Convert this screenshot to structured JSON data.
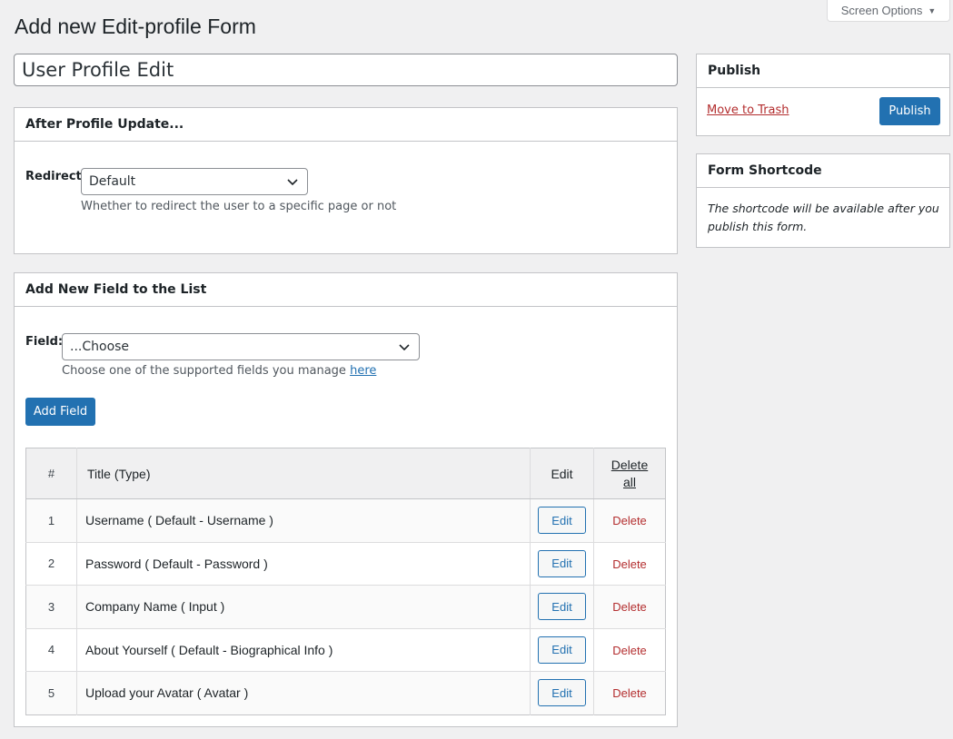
{
  "screen_options": {
    "label": "Screen Options"
  },
  "page_title": "Add new Edit-profile Form",
  "form_title": {
    "value": "User Profile Edit"
  },
  "after_update": {
    "header": "After Profile Update...",
    "redirect_label": "Redirect:",
    "redirect_value": "Default",
    "redirect_hint": "Whether to redirect the user to a specific page or not"
  },
  "add_field": {
    "header": "Add New Field to the List",
    "field_label": "Field:",
    "field_value": "...Choose",
    "hint_text": "Choose one of the supported fields you manage",
    "hint_link": "here",
    "button": "Add Field"
  },
  "table": {
    "headers": {
      "num": "#",
      "title": "Title (Type)",
      "edit": "Edit",
      "delete_all": "Delete all"
    },
    "edit_label": "Edit",
    "delete_label": "Delete",
    "rows": [
      {
        "num": "1",
        "title": "Username ( Default - Username )"
      },
      {
        "num": "2",
        "title": "Password ( Default - Password )"
      },
      {
        "num": "3",
        "title": "Company Name ( Input )"
      },
      {
        "num": "4",
        "title": "About Yourself ( Default - Biographical Info )"
      },
      {
        "num": "5",
        "title": "Upload your Avatar ( Avatar )"
      }
    ]
  },
  "publish": {
    "header": "Publish",
    "trash_label": "Move to Trash",
    "button": "Publish"
  },
  "shortcode": {
    "header": "Form Shortcode",
    "text": "The shortcode will be available after you publish this form."
  },
  "colors": {
    "primary": "#2271b1",
    "danger": "#b32d2e",
    "background": "#f0f0f1"
  }
}
